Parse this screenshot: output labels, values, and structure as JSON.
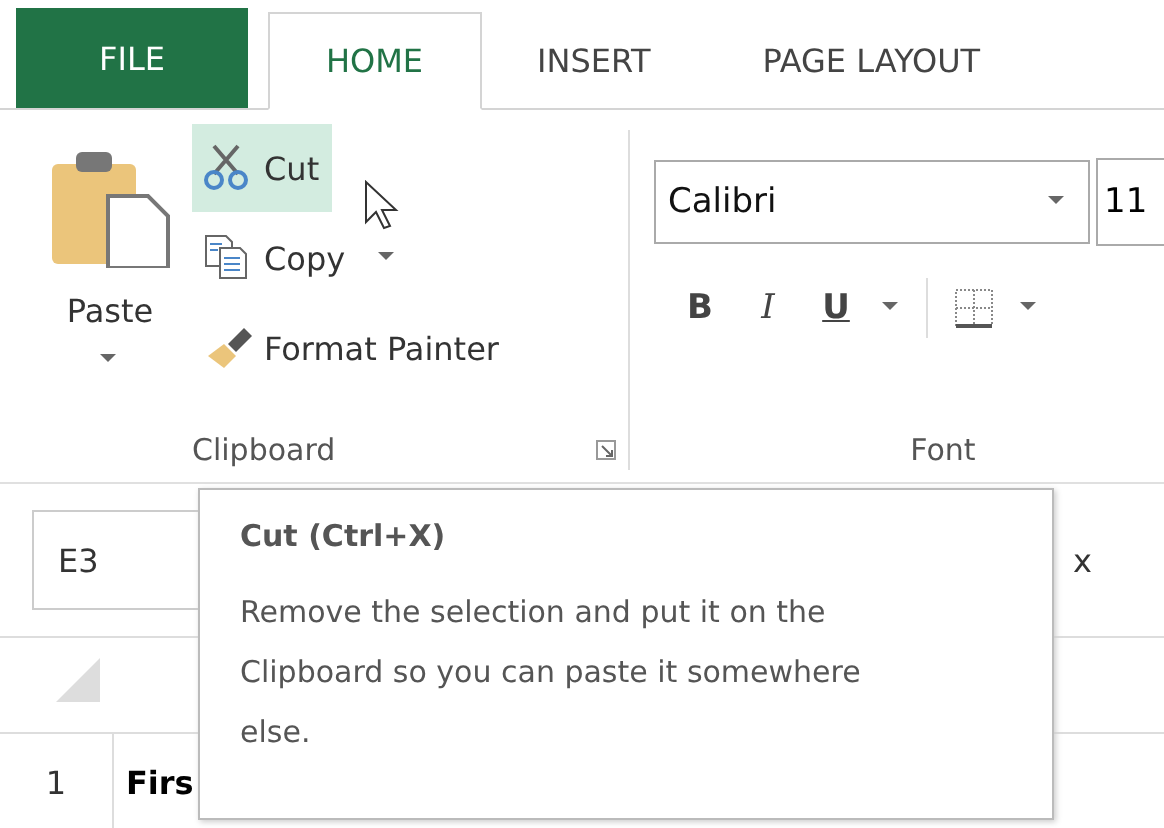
{
  "tabs": [
    {
      "label": "FILE",
      "kind": "file",
      "selected": false
    },
    {
      "label": "HOME",
      "kind": "tab",
      "selected": true
    },
    {
      "label": "INSERT",
      "kind": "tab",
      "selected": false
    },
    {
      "label": "PAGE LAYOUT",
      "kind": "tab",
      "selected": false
    }
  ],
  "clipboard": {
    "label": "Clipboard",
    "paste": "Paste",
    "actions": [
      {
        "label": "Cut",
        "kind": "cut",
        "hovered": true,
        "dropdown": false
      },
      {
        "label": "Copy",
        "kind": "copy",
        "hovered": false,
        "dropdown": true
      },
      {
        "label": "Format Painter",
        "kind": "painter",
        "hovered": false,
        "dropdown": false
      }
    ]
  },
  "font": {
    "label": "Font",
    "font_name": "Calibri",
    "font_size": "11",
    "styles": [
      {
        "label": "B",
        "kind": "bold"
      },
      {
        "label": "I",
        "kind": "italic"
      },
      {
        "label": "U",
        "kind": "underline"
      }
    ]
  },
  "name_box": "E3",
  "formula_bar": {
    "column_2": "x"
  },
  "rows": [
    {
      "header": "1",
      "cell": "Firs"
    }
  ],
  "tooltip": {
    "title": "Cut (Ctrl+X)",
    "body": "Remove the selection and put it on the Clipboard so you can paste it somewhere else."
  }
}
